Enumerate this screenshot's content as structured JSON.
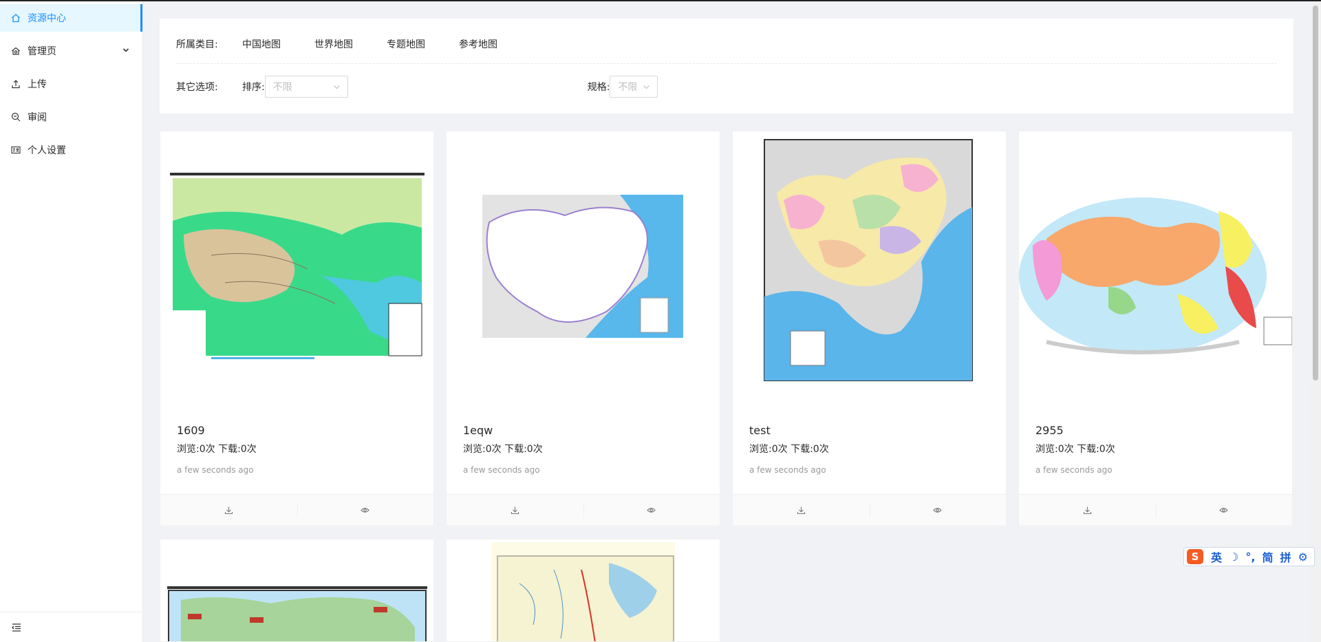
{
  "sidebar": {
    "items": [
      {
        "label": "资源中心",
        "icon": "home-icon",
        "active": true
      },
      {
        "label": "管理页",
        "icon": "setting-icon",
        "has_submenu": true
      },
      {
        "label": "上传",
        "icon": "upload-icon"
      },
      {
        "label": "审阅",
        "icon": "zoom-icon"
      },
      {
        "label": "个人设置",
        "icon": "idcard-icon"
      }
    ],
    "collapse_icon": "menu-fold-icon"
  },
  "filter": {
    "category_label": "所属类目:",
    "categories": [
      "中国地图",
      "世界地图",
      "专题地图",
      "参考地图"
    ],
    "other_label": "其它选项:",
    "sort_label": "排序:",
    "sort_value": "不限",
    "spec_label": "规格:",
    "spec_value": "不限"
  },
  "cards": [
    {
      "title": "1609",
      "stats": "浏览:0次 下载:0次",
      "time": "a few seconds ago",
      "map": "china-physical"
    },
    {
      "title": "1eqw",
      "stats": "浏览:0次 下载:0次",
      "time": "a few seconds ago",
      "map": "china-blank"
    },
    {
      "title": "test",
      "stats": "浏览:0次 下载:0次",
      "time": "a few seconds ago",
      "map": "china-political"
    },
    {
      "title": "2955",
      "stats": "浏览:0次 下载:0次",
      "time": "a few seconds ago",
      "map": "world-political"
    }
  ],
  "card_actions": [
    "download-icon",
    "eye-icon"
  ],
  "ime": {
    "logo": "S",
    "items": [
      "英",
      "☽",
      "°,",
      "简",
      "拼",
      "⚙"
    ]
  },
  "colors": {
    "primary": "#1890ff",
    "active_bg": "#e6f7ff",
    "page_bg": "#f0f2f5"
  }
}
